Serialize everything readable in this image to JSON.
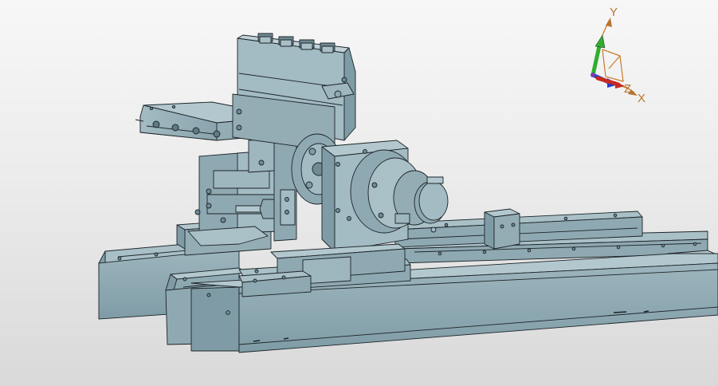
{
  "viewport": {
    "background_top": "#f7f7f7",
    "background_bottom": "#d9d9d9"
  },
  "model": {
    "face_color": "#8fa9b2",
    "face_light": "#a9c0c7",
    "face_dark": "#6f8b95",
    "edge_color": "#1c2428"
  },
  "triad": {
    "labels": {
      "y": "Y",
      "z": "Z",
      "x": "X"
    },
    "colors": {
      "y": "#2fae2f",
      "z": "#1f3ed6",
      "x": "#c8281e",
      "frame": "#c87b2a",
      "label": "#b8752f"
    }
  }
}
